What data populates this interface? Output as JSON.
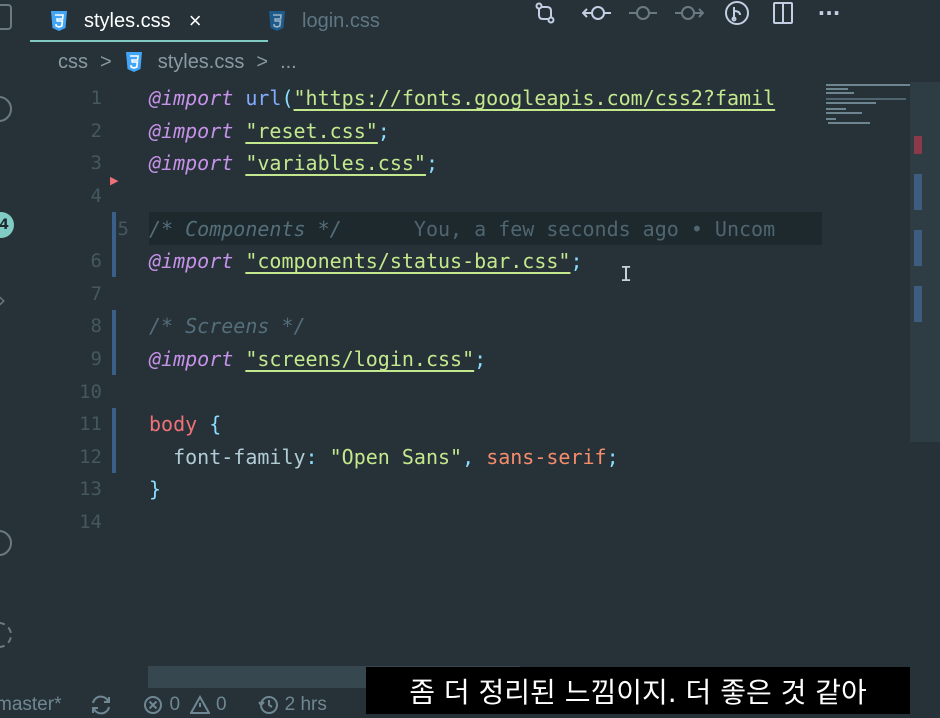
{
  "tabs": [
    {
      "label": "styles.css",
      "active": true,
      "icon": "css3-icon"
    },
    {
      "label": "login.css",
      "active": false,
      "icon": "css3-icon"
    }
  ],
  "tab_close_glyph": "×",
  "toolbar_icons": [
    "source-control-icon",
    "go-back-commit-icon",
    "current-commit-icon",
    "go-forward-commit-icon",
    "git-graph-icon",
    "split-editor-icon",
    "more-actions-icon"
  ],
  "more_glyph": "···",
  "activity_badge": "4",
  "breadcrumb": {
    "folder": "css",
    "sep": ">",
    "file": "styles.css",
    "more": "..."
  },
  "editor": {
    "line_numbers": [
      "1",
      "2",
      "3",
      "4",
      "5",
      "6",
      "7",
      "8",
      "9",
      "10",
      "11",
      "12",
      "13",
      "14"
    ],
    "line1": {
      "kw": "@import",
      "fn": "url",
      "paren_open": "(",
      "str": "\"https://fonts.googleapis.com/css2?famil"
    },
    "line2": {
      "kw": "@import",
      "str": "\"reset.css\"",
      "semi": ";"
    },
    "line3": {
      "kw": "@import",
      "str": "\"variables.css\"",
      "semi": ";"
    },
    "line5": {
      "comment": "/* Components */",
      "blame": "You, a few seconds ago • Uncom"
    },
    "line6": {
      "kw": "@import",
      "str": "\"components/status-bar.css\"",
      "semi": ";"
    },
    "line8": {
      "comment": "/* Screens */"
    },
    "line9": {
      "kw": "@import",
      "str": "\"screens/login.css\"",
      "semi": ";"
    },
    "line11": {
      "selector": "body",
      "brace": "{"
    },
    "line12": {
      "prop": "font-family",
      "colon": ":",
      "str": "\"Open Sans\"",
      "comma": ",",
      "value": "sans-serif",
      "semi": ";"
    },
    "line13": {
      "brace": "}"
    }
  },
  "cursor_glyph": "I",
  "status": {
    "branch": "master*",
    "errors": "0",
    "warnings": "0",
    "time": "2 hrs"
  },
  "subtitle": "좀 더 정리된 느낌이지. 더 좋은 것 같아",
  "colors": {
    "background": "#263238",
    "keyword": "#c792ea",
    "string": "#c3e88d",
    "function": "#82aaff",
    "comment": "#546e7a",
    "selector": "#f07178",
    "value": "#f78c6c",
    "accent": "#80cbc4"
  }
}
